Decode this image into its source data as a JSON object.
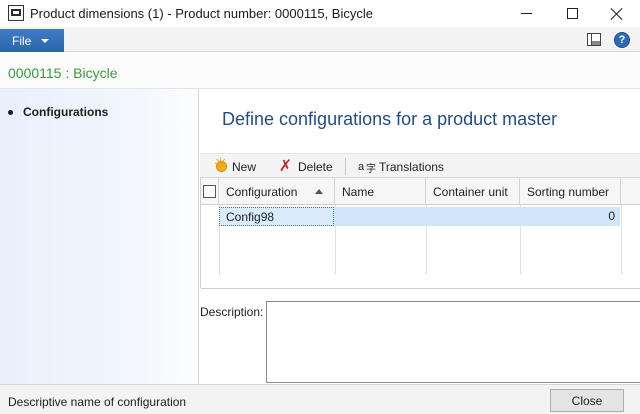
{
  "window": {
    "title": "Product dimensions (1) - Product number: 0000115, Bicycle",
    "icon": "app-form-icon",
    "controls": {
      "minimize": "minimize-icon",
      "maximize": "maximize-icon",
      "close": "close-icon"
    }
  },
  "menu": {
    "file_label": "File"
  },
  "record": {
    "title": "0000115 : Bicycle"
  },
  "nav": {
    "items": [
      {
        "label": "Configurations"
      }
    ]
  },
  "main": {
    "heading": "Define configurations for a product master",
    "toolbar": {
      "new_label": "New",
      "delete_label": "Delete",
      "translations_label": "Translations"
    },
    "grid": {
      "columns": [
        "Configuration",
        "Name",
        "Container unit",
        "Sorting number"
      ],
      "rows": [
        {
          "configuration": "Config98",
          "name": "",
          "container_unit": "",
          "sorting_number": "0"
        }
      ]
    },
    "description_label": "Description:"
  },
  "status": {
    "text": "Descriptive name of configuration",
    "close_label": "Close"
  },
  "colors": {
    "file_button": "#2b64ad",
    "record_title": "#3a9a3a",
    "heading": "#1f4d8a",
    "selected_row": "#cfe6f8",
    "delete_icon": "#c4262e"
  }
}
